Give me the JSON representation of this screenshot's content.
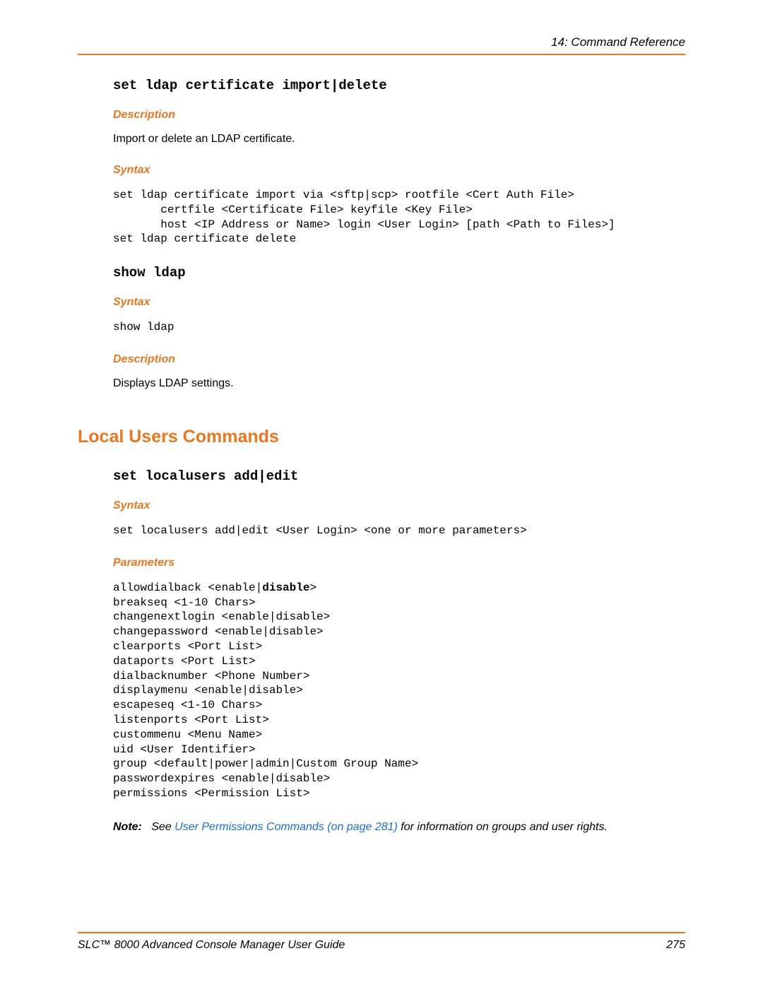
{
  "header": {
    "chapter": "14: Command Reference"
  },
  "cmd1": {
    "title": "set ldap certificate import|delete",
    "desc_label": "Description",
    "desc_text": "Import or delete an LDAP certificate.",
    "syntax_label": "Syntax",
    "syntax_code": "set ldap certificate import via <sftp|scp> rootfile <Cert Auth File>\n       certfile <Certificate File> keyfile <Key File>\n       host <IP Address or Name> login <User Login> [path <Path to Files>]\nset ldap certificate delete"
  },
  "cmd2": {
    "title": "show ldap",
    "syntax_label": "Syntax",
    "syntax_code": "show ldap",
    "desc_label": "Description",
    "desc_text": "Displays LDAP settings."
  },
  "section_heading": "Local Users Commands",
  "cmd3": {
    "title": "set localusers add|edit",
    "syntax_label": "Syntax",
    "syntax_code": "set localusers add|edit <User Login> <one or more parameters>",
    "params_label": "Parameters",
    "params_code_pre": "allowdialback <enable|",
    "params_bold": "disable",
    "params_code_post": ">\nbreakseq <1-10 Chars>\nchangenextlogin <enable|disable>\nchangepassword <enable|disable>\nclearports <Port List>\ndataports <Port List>\ndialbacknumber <Phone Number>\ndisplaymenu <enable|disable>\nescapeseq <1-10 Chars>\nlistenports <Port List>\ncustommenu <Menu Name>\nuid <User Identifier>\ngroup <default|power|admin|Custom Group Name>\npasswordexpires <enable|disable>\npermissions <Permission List>"
  },
  "note": {
    "label": "Note:",
    "pre": "See ",
    "link": "User Permissions Commands (on page 281)",
    "post": " for information on groups and user rights."
  },
  "footer": {
    "left": "SLC™ 8000 Advanced Console Manager User Guide",
    "right": "275"
  }
}
